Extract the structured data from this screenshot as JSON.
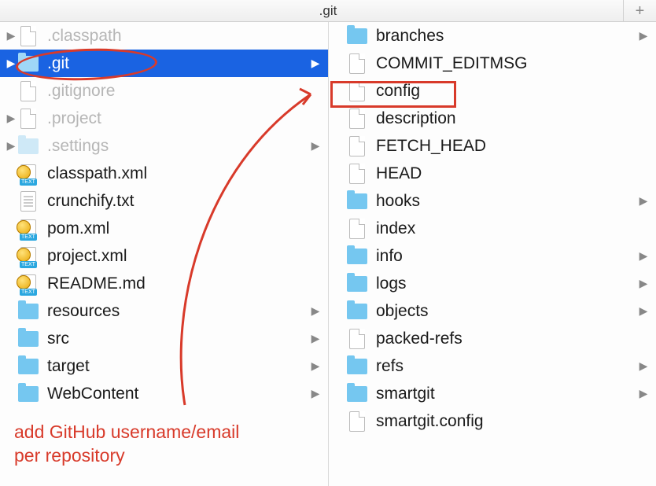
{
  "title": ".git",
  "plus": "+",
  "left": [
    {
      "label": ".classpath",
      "dim": true,
      "icon": "file",
      "expand_left": true,
      "expand_right": false
    },
    {
      "label": ".git",
      "dim": true,
      "icon": "folder",
      "selected": true,
      "expand_left": true,
      "expand_right": true
    },
    {
      "label": ".gitignore",
      "dim": true,
      "icon": "file",
      "expand_left": false,
      "expand_right": false
    },
    {
      "label": ".project",
      "dim": true,
      "icon": "file",
      "expand_left": true,
      "expand_right": false
    },
    {
      "label": ".settings",
      "dim": true,
      "icon": "folder-dim",
      "expand_left": true,
      "expand_right": true
    },
    {
      "label": "classpath.xml",
      "dim": false,
      "icon": "xml",
      "expand_left": false,
      "expand_right": false
    },
    {
      "label": "crunchify.txt",
      "dim": false,
      "icon": "txt",
      "expand_left": false,
      "expand_right": false
    },
    {
      "label": "pom.xml",
      "dim": false,
      "icon": "xml",
      "expand_left": false,
      "expand_right": false
    },
    {
      "label": "project.xml",
      "dim": false,
      "icon": "xml",
      "expand_left": false,
      "expand_right": false
    },
    {
      "label": "README.md",
      "dim": false,
      "icon": "xml",
      "expand_left": false,
      "expand_right": false
    },
    {
      "label": "resources",
      "dim": false,
      "icon": "folder",
      "expand_left": false,
      "expand_right": true
    },
    {
      "label": "src",
      "dim": false,
      "icon": "folder",
      "expand_left": false,
      "expand_right": true
    },
    {
      "label": "target",
      "dim": false,
      "icon": "folder",
      "expand_left": false,
      "expand_right": true
    },
    {
      "label": "WebContent",
      "dim": false,
      "icon": "folder",
      "expand_left": false,
      "expand_right": true
    }
  ],
  "right": [
    {
      "label": "branches",
      "icon": "folder",
      "expand_right": true
    },
    {
      "label": "COMMIT_EDITMSG",
      "icon": "file",
      "expand_right": false
    },
    {
      "label": "config",
      "icon": "file",
      "expand_right": false
    },
    {
      "label": "description",
      "icon": "file",
      "expand_right": false
    },
    {
      "label": "FETCH_HEAD",
      "icon": "file",
      "expand_right": false
    },
    {
      "label": "HEAD",
      "icon": "file",
      "expand_right": false
    },
    {
      "label": "hooks",
      "icon": "folder",
      "expand_right": true
    },
    {
      "label": "index",
      "icon": "file",
      "expand_right": false
    },
    {
      "label": "info",
      "icon": "folder",
      "expand_right": true
    },
    {
      "label": "logs",
      "icon": "folder",
      "expand_right": true
    },
    {
      "label": "objects",
      "icon": "folder",
      "expand_right": true
    },
    {
      "label": "packed-refs",
      "icon": "file",
      "expand_right": false
    },
    {
      "label": "refs",
      "icon": "folder",
      "expand_right": true
    },
    {
      "label": "smartgit",
      "icon": "folder",
      "expand_right": true
    },
    {
      "label": "smartgit.config",
      "icon": "file",
      "expand_right": false
    }
  ],
  "annotation_text_line1": "add GitHub username/email",
  "annotation_text_line2": "per repository",
  "colors": {
    "selection": "#1a63e2",
    "annotation": "#d83a2a",
    "folder": "#75c7f0"
  }
}
